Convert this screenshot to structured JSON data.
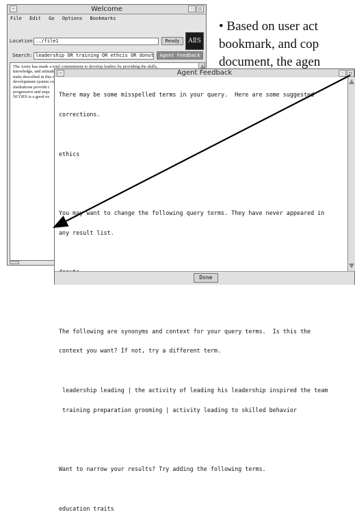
{
  "slide": {
    "lines": [
      "• Based on user act",
      "bookmark, and cop",
      "document, the agen"
    ]
  },
  "welcome": {
    "title": "Welcome",
    "menu": [
      "File",
      "Edit",
      "Go",
      "Options",
      "Bookmarks"
    ],
    "location_label": "Location:",
    "location_value": "../file1",
    "status": "Ready",
    "logo_text": "AⅡS",
    "search_label": "Search:",
    "search_value": "leadership OR training OR ethcis OR donuts",
    "agent_button": "Agent Feedback",
    "document_lines": [
      "The Army has made a total commitment to develop leaders by providing the skills,",
      "knowledge, and attitudes necessary for them to exhibit the leadership characteristics and",
      "traits described in this manual. This objective is accomplished through a dynamic leader",
      "development system consisting of three equally important pillars: Schools, Three",
      "institutions provide t",
      "progressive and sequ",
      "NCOES is a good ex"
    ]
  },
  "feedback": {
    "title": "Agent Feedback",
    "lines": [
      "There may be some misspelled terms in your query.  Here are some suggested",
      "corrections.",
      "",
      "ethics",
      "",
      "",
      "You may want to change the following query terms. They have never appeared in",
      "any result list.",
      "",
      "donuts",
      "",
      "",
      "The following are synonyms and context for your query terms.  Is this the",
      "context you want? If not, try a different term.",
      "",
      " leadership leading | the activity of leading his leadership inspired the team",
      " training preparation grooming | activity leading to skilled behavior",
      "",
      "",
      "Want to narrow your results? Try adding the following terms.",
      "",
      "education traits"
    ],
    "done_button": "Done"
  }
}
